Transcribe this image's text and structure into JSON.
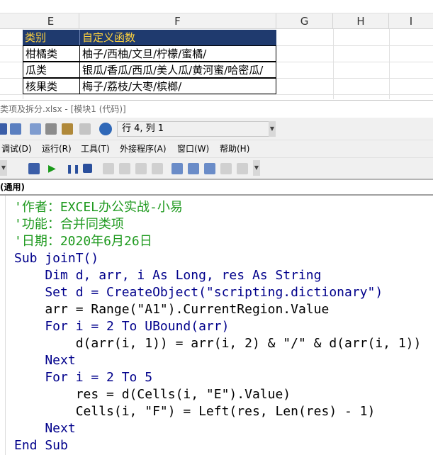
{
  "sheet": {
    "columns": [
      "E",
      "F",
      "G",
      "H",
      "I"
    ],
    "header": {
      "category": "类别",
      "function": "自定义函数"
    },
    "rows": [
      {
        "category": "柑橘类",
        "value": "柚子/西柚/文旦/柠檬/蜜橘/"
      },
      {
        "category": "瓜类",
        "value": "银瓜/香瓜/西瓜/美人瓜/黄河蜜/哈密瓜/"
      },
      {
        "category": "核果类",
        "value": "梅子/荔枝/大枣/槟榔/"
      }
    ],
    "header_bg": "#1f3a6e",
    "header_fg": "#ffd33d"
  },
  "vbe": {
    "title": "类项及拆分.xlsx - [模块1 (代码)]",
    "position_label": "行 4, 列 1",
    "menu": [
      "调试(D)",
      "运行(R)",
      "工具(T)",
      "外接程序(A)",
      "窗口(W)",
      "帮助(H)"
    ],
    "procedure_box": "(通用)",
    "code": [
      "'作者：EXCEL办公实战-小易",
      "'功能：合并同类项",
      "'日期：2020年6月26日",
      "Sub joinT()",
      "    Dim d, arr, i As Long, res As String",
      "    Set d = CreateObject(\"scripting.dictionary\")",
      "    arr = Range(\"A1\").CurrentRegion.Value",
      "    For i = 2 To UBound(arr)",
      "        d(arr(i, 1)) = arr(i, 2) & \"/\" & d(arr(i, 1))",
      "    Next",
      "    For i = 2 To 5",
      "        res = d(Cells(i, \"E\").Value)",
      "        Cells(i, \"F\") = Left(res, Len(res) - 1)",
      "    Next",
      "End Sub"
    ],
    "colors": {
      "comment": "#1f9a1f",
      "keyword": "#00008b"
    }
  }
}
